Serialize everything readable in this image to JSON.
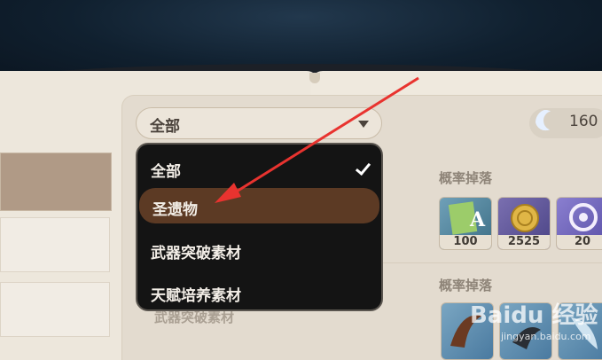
{
  "filter": {
    "selected": "全部",
    "options": [
      {
        "label": "全部",
        "checked": true
      },
      {
        "label": "圣遗物",
        "checked": false
      },
      {
        "label": "武器突破素材",
        "checked": false
      },
      {
        "label": "天赋培养素材",
        "checked": false
      }
    ]
  },
  "resin": {
    "count": "160"
  },
  "drops": {
    "section1_title": "概率掉落",
    "section1_items": [
      {
        "icon": "adventure-exp-icon",
        "qty": "100"
      },
      {
        "icon": "mora-coin-icon",
        "qty": "2525"
      },
      {
        "icon": "companionship-exp-icon",
        "qty": "20"
      }
    ],
    "section2_title": "概率掉落",
    "section2_items": [
      {
        "icon": "horn-material-icon"
      },
      {
        "icon": "claw-material-icon"
      },
      {
        "icon": "fang-material-icon"
      }
    ],
    "faded_label": "武器突破素材"
  },
  "watermark": {
    "logo": "Baidu 经验",
    "url": "jingyan.baidu.com"
  },
  "colors": {
    "menu_bg": "#141414",
    "menu_highlight": "#5c3a24",
    "annotation_arrow": "#e8332f"
  }
}
